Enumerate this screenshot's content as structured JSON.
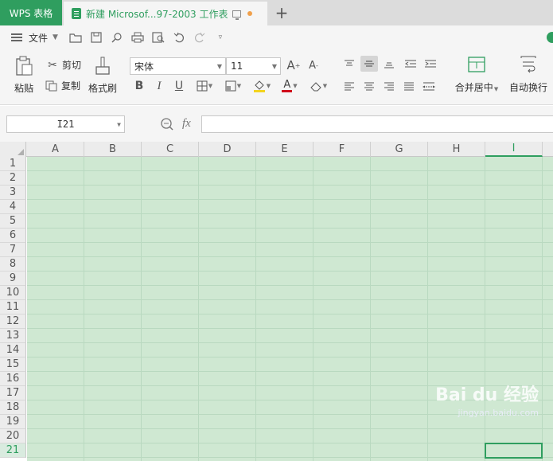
{
  "titlebar": {
    "app_tab": "WPS 表格",
    "doc_tab": "新建 Microsof...97-2003 工作表",
    "new_tab": "+"
  },
  "menubar": {
    "file_label": "文件"
  },
  "ribbon": {
    "paste": "粘贴",
    "cut": "剪切",
    "copy": "复制",
    "format_painter": "格式刷",
    "font_name": "宋体",
    "font_size": "11",
    "bold": "B",
    "italic": "I",
    "underline": "U",
    "font_color_glyph": "A",
    "merge_center": "合并居中",
    "wrap_text": "自动换行"
  },
  "formula_bar": {
    "name_box": "I21",
    "fx": "fx",
    "formula_value": ""
  },
  "sheet": {
    "columns": [
      "A",
      "B",
      "C",
      "D",
      "E",
      "F",
      "G",
      "H",
      "I"
    ],
    "rows": [
      "1",
      "2",
      "3",
      "4",
      "5",
      "6",
      "7",
      "8",
      "9",
      "10",
      "11",
      "12",
      "13",
      "14",
      "15",
      "16",
      "17",
      "18",
      "19",
      "20",
      "21"
    ],
    "selected_column": "I",
    "selected_row": "21"
  },
  "watermark": {
    "brand": "Bai du 经验",
    "url": "jingyan.baidu.com"
  },
  "colors": {
    "accent": "#2f9e5f",
    "cell_fill": "#cfe8d2"
  }
}
